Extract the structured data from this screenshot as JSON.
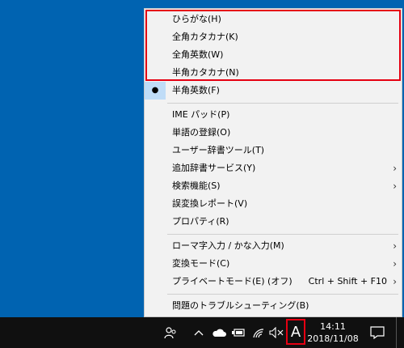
{
  "menu": {
    "items": [
      {
        "label": "ひらがな(H)",
        "checked": false,
        "shortcut": "",
        "submenu": false
      },
      {
        "label": "全角カタカナ(K)",
        "checked": false,
        "shortcut": "",
        "submenu": false
      },
      {
        "label": "全角英数(W)",
        "checked": false,
        "shortcut": "",
        "submenu": false
      },
      {
        "label": "半角カタカナ(N)",
        "checked": false,
        "shortcut": "",
        "submenu": false
      },
      {
        "label": "半角英数(F)",
        "checked": true,
        "shortcut": "",
        "submenu": false
      },
      {
        "label": "IME パッド(P)",
        "checked": false,
        "shortcut": "",
        "submenu": false
      },
      {
        "label": "単語の登録(O)",
        "checked": false,
        "shortcut": "",
        "submenu": false
      },
      {
        "label": "ユーザー辞書ツール(T)",
        "checked": false,
        "shortcut": "",
        "submenu": false
      },
      {
        "label": "追加辞書サービス(Y)",
        "checked": false,
        "shortcut": "",
        "submenu": true
      },
      {
        "label": "検索機能(S)",
        "checked": false,
        "shortcut": "",
        "submenu": true
      },
      {
        "label": "誤変換レポート(V)",
        "checked": false,
        "shortcut": "",
        "submenu": false
      },
      {
        "label": "プロパティ(R)",
        "checked": false,
        "shortcut": "",
        "submenu": false
      },
      {
        "label": "ローマ字入力 / かな入力(M)",
        "checked": false,
        "shortcut": "",
        "submenu": true
      },
      {
        "label": "変換モード(C)",
        "checked": false,
        "shortcut": "",
        "submenu": true
      },
      {
        "label": "プライベートモード(E) (オフ)",
        "checked": false,
        "shortcut": "Ctrl + Shift + F10",
        "submenu": true
      },
      {
        "label": "問題のトラブルシューティング(B)",
        "checked": false,
        "shortcut": "",
        "submenu": false
      }
    ],
    "check_mark": "●",
    "submenu_arrow": "›"
  },
  "taskbar": {
    "ime_indicator": "A",
    "time": "14:11",
    "date": "2018/11/08",
    "icons": [
      "people-icon",
      "chevron-up-icon",
      "onedrive-icon",
      "battery-icon",
      "wifi-icon",
      "volume-muted-icon",
      "notification-icon"
    ]
  },
  "colors": {
    "desktop": "#0063b1",
    "menu_bg": "#f2f2f2",
    "check_bg": "#bfdcf7",
    "highlight": "#e60012",
    "taskbar": "#101010"
  }
}
